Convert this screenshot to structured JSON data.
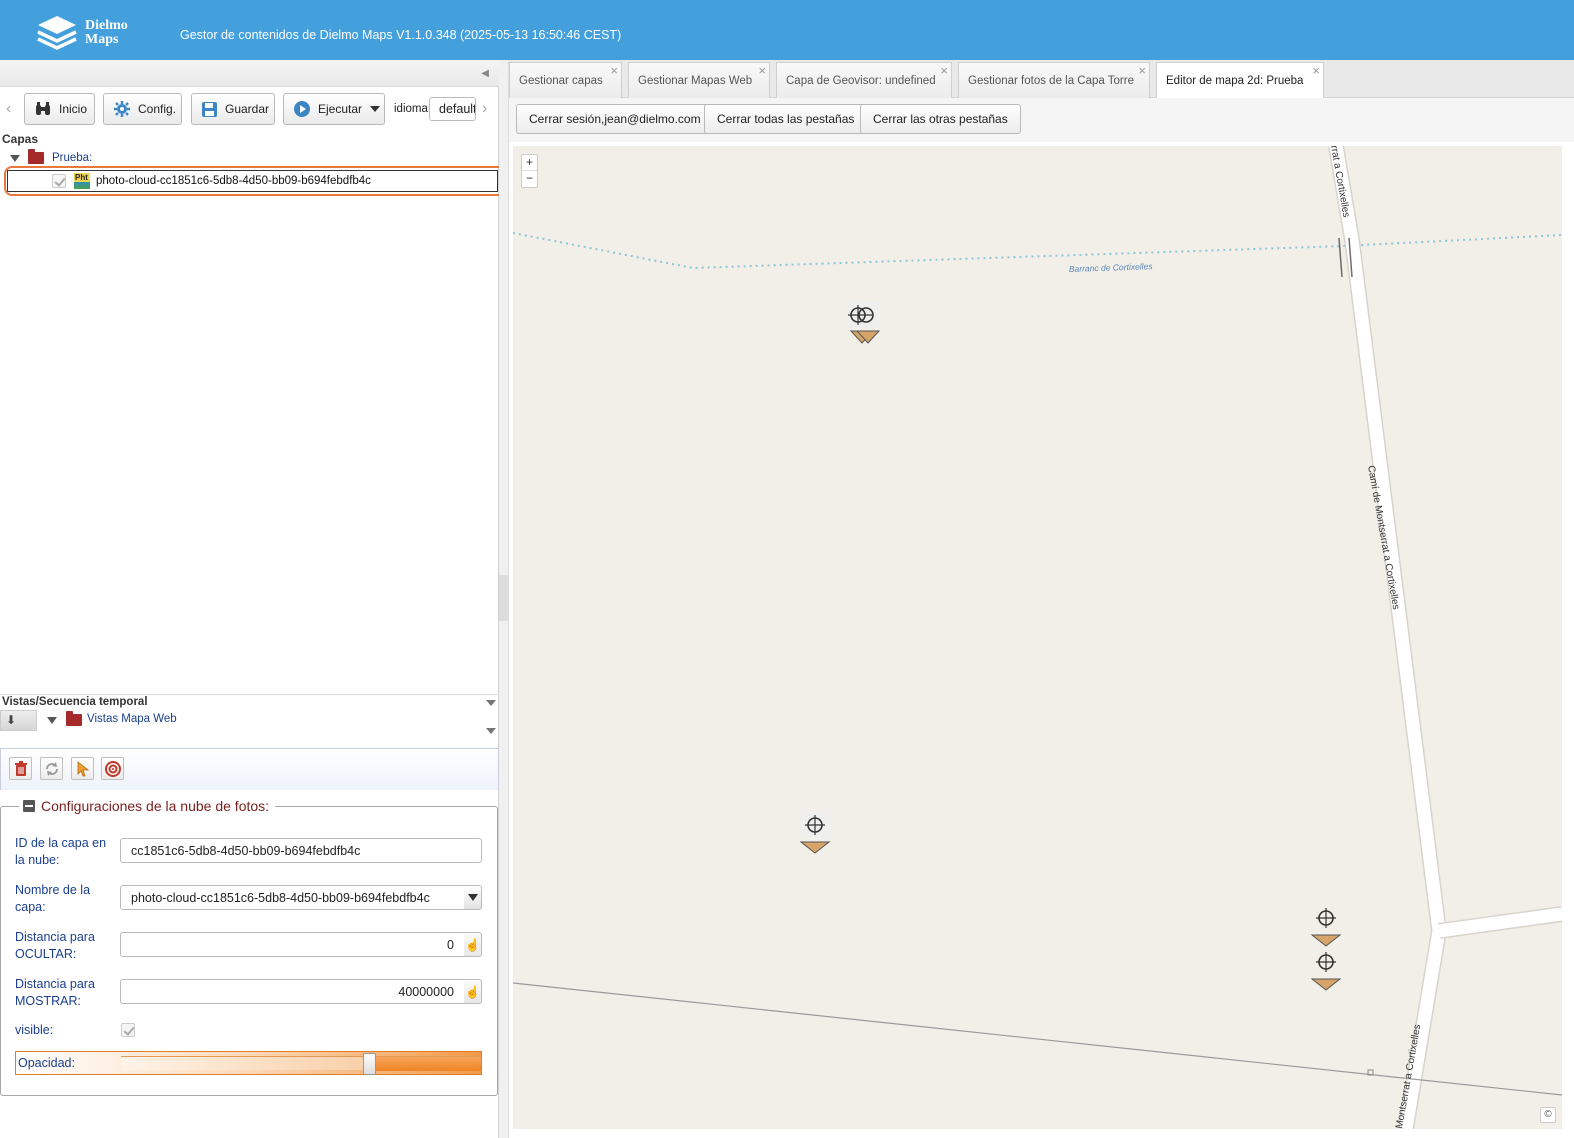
{
  "header": {
    "logo_line1": "Dielmo",
    "logo_line2": "Maps",
    "title": "Gestor de contenidos de Dielmo Maps V1.1.0.348 (2025-05-13 16:50:46 CEST)"
  },
  "toolbar": {
    "inicio": "Inicio",
    "config": "Config.",
    "guardar": "Guardar",
    "ejecutar": "Ejecutar",
    "idioma_label": "idioma:",
    "idioma_value": "default"
  },
  "layers": {
    "heading": "Capas",
    "group": "Prueba:",
    "layer_icon_text": "Pht",
    "layer_name": "photo-cloud-cc1851c6-5db8-4d50-bb09-b694febdfb4c"
  },
  "views": {
    "heading": "Vistas/Secuencia temporal",
    "folder": "Vistas Mapa Web"
  },
  "config": {
    "legend": "Configuraciones de la nube de fotos:",
    "id_label_1": "ID de la capa en",
    "id_label_2": "la nube:",
    "id_value": "cc1851c6-5db8-4d50-bb09-b694febdfb4c",
    "name_label_1": "Nombre de la",
    "name_label_2": "capa:",
    "name_value": "photo-cloud-cc1851c6-5db8-4d50-bb09-b694febdfb4c",
    "hide_label_1": "Distancia para",
    "hide_label_2": "OCULTAR:",
    "hide_value": "0",
    "show_label_1": "Distancia para",
    "show_label_2": "MOSTRAR:",
    "show_value": "40000000",
    "visible_label": "visible:",
    "visible_checked": true,
    "opacity_label": "Opacidad:",
    "opacity_value": 0.69
  },
  "tabs": [
    {
      "label": "Gestionar capas",
      "active": false
    },
    {
      "label": "Gestionar Mapas Web",
      "active": false
    },
    {
      "label": "Capa de Geovisor: undefined",
      "active": false
    },
    {
      "label": "Gestionar fotos de la Capa Torre",
      "active": false
    },
    {
      "label": "Editor de mapa 2d: Prueba",
      "active": true
    }
  ],
  "actions": {
    "logout": "Cerrar sesión,jean@dielmo.com",
    "close_all": "Cerrar todas las pestañas",
    "close_others": "Cerrar las otras pestañas"
  },
  "map": {
    "zoom_in": "+",
    "zoom_out": "−",
    "attribution": "©",
    "labels": {
      "stream": "Barranc de Cortixelles",
      "road_top": "rrat a Cortixelles",
      "road_mid": "Camí de Montserrat a Cortixelles",
      "road_bottom": "Montserrat a Cortixelles"
    }
  },
  "colors": {
    "header_bg": "#43a0dc",
    "highlight": "#e8793b",
    "map_bg": "#f2efe9"
  }
}
